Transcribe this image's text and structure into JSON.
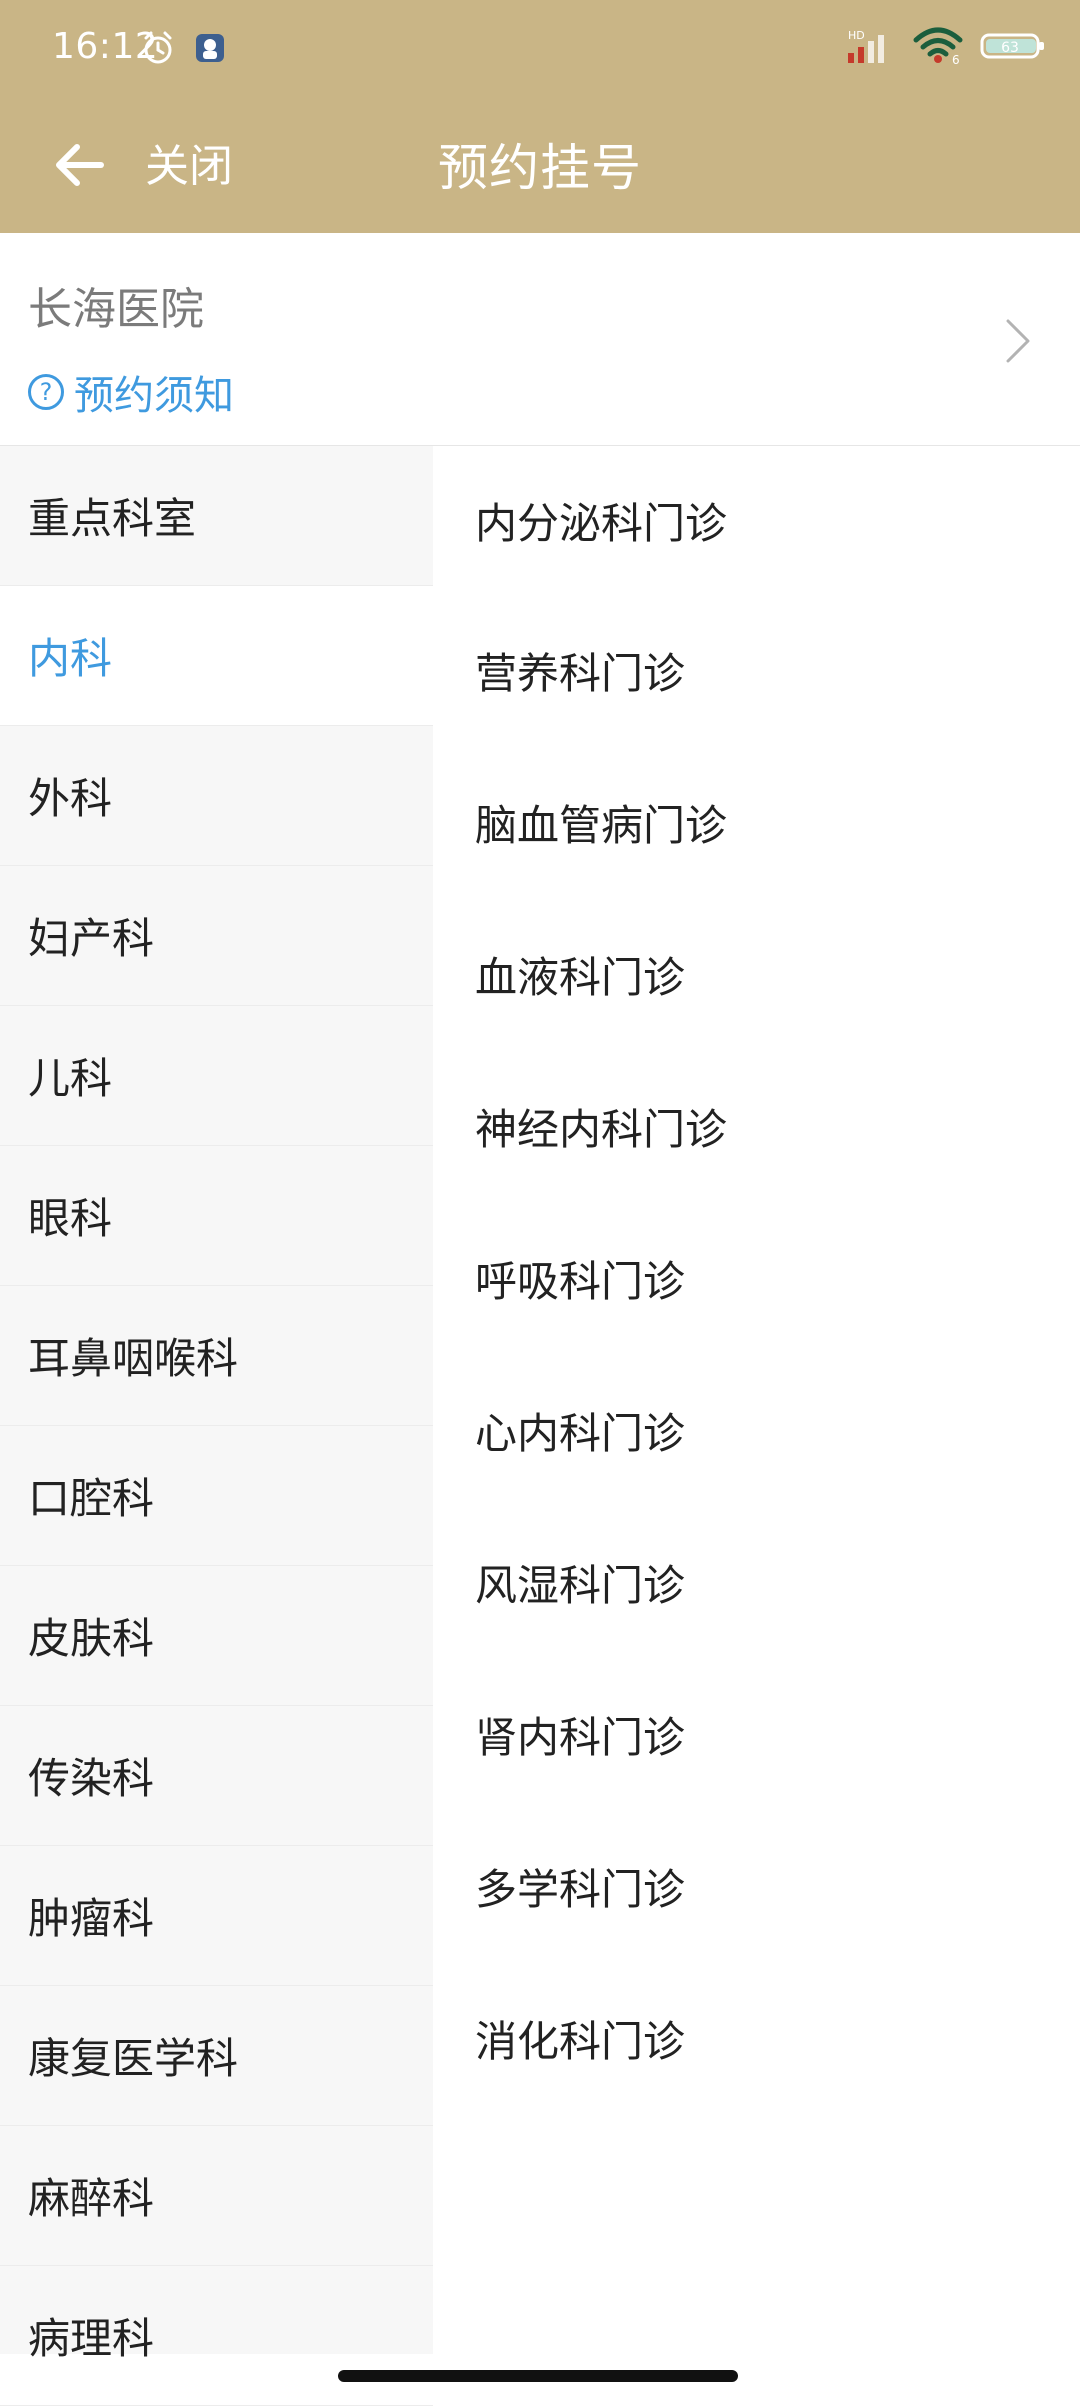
{
  "status_bar": {
    "time": "16:12",
    "battery": "63",
    "network_label": "HD",
    "wifi_label": "6"
  },
  "nav": {
    "close_label": "关闭",
    "title": "预约挂号"
  },
  "hospital": {
    "name": "长海医院",
    "notice_label": "预约须知"
  },
  "departments": [
    {
      "name": "重点科室",
      "active": false
    },
    {
      "name": "内科",
      "active": true
    },
    {
      "name": "外科",
      "active": false
    },
    {
      "name": "妇产科",
      "active": false
    },
    {
      "name": "儿科",
      "active": false
    },
    {
      "name": "眼科",
      "active": false
    },
    {
      "name": "耳鼻咽喉科",
      "active": false
    },
    {
      "name": "口腔科",
      "active": false
    },
    {
      "name": "皮肤科",
      "active": false
    },
    {
      "name": "传染科",
      "active": false
    },
    {
      "name": "肿瘤科",
      "active": false
    },
    {
      "name": "康复医学科",
      "active": false
    },
    {
      "name": "麻醉科",
      "active": false
    },
    {
      "name": "病理科",
      "active": false
    }
  ],
  "clinics": [
    "内分泌科门诊",
    "营养科门诊",
    "脑血管病门诊",
    "血液科门诊",
    "神经内科门诊",
    "呼吸科门诊",
    "心内科门诊",
    "风湿科门诊",
    "肾内科门诊",
    "多学科门诊",
    "消化科门诊"
  ],
  "colors": {
    "header": "#C9B586",
    "accent": "#3f9adf"
  }
}
